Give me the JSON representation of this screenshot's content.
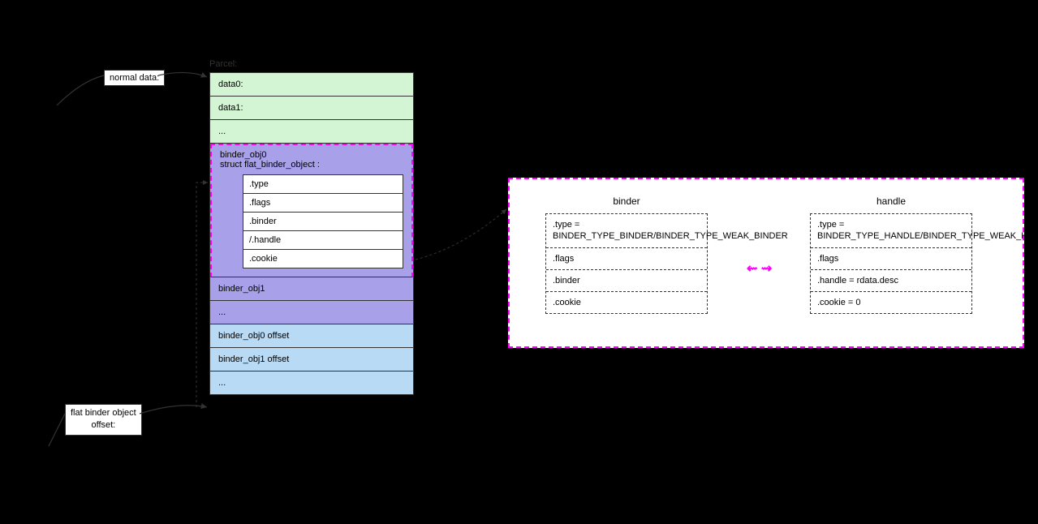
{
  "parcel_label": "Parcel:",
  "side_labels": {
    "normal": "normal data:",
    "flat": "flat binder object\noffset:"
  },
  "stack": {
    "data0": "data0:",
    "data1": "data1:",
    "dots1": "...",
    "binder_obj0_title": "binder_obj0",
    "binder_obj0_sub": "struct flat_binder_object :",
    "fields": {
      "type": ".type",
      "flags": ".flags",
      "binder": ".binder",
      "handle": "/.handle",
      "cookie": ".cookie"
    },
    "binder_obj1": "binder_obj1",
    "dots2": "...",
    "offset0": "binder_obj0 offset",
    "offset1": "binder_obj1 offset",
    "dots3": "..."
  },
  "detail": {
    "binder_title": "binder",
    "handle_title": "handle",
    "binder": {
      "type": ".type = BINDER_TYPE_BINDER/BINDER_TYPE_WEAK_BINDER",
      "flags": ".flags",
      "binder": ".binder",
      "cookie": ".cookie"
    },
    "handle": {
      "type": ".type = BINDER_TYPE_HANDLE/BINDER_TYPE_WEAK_HANDLE",
      "flags": ".flags",
      "handle": ".handle = rdata.desc",
      "cookie": ".cookie = 0"
    }
  }
}
